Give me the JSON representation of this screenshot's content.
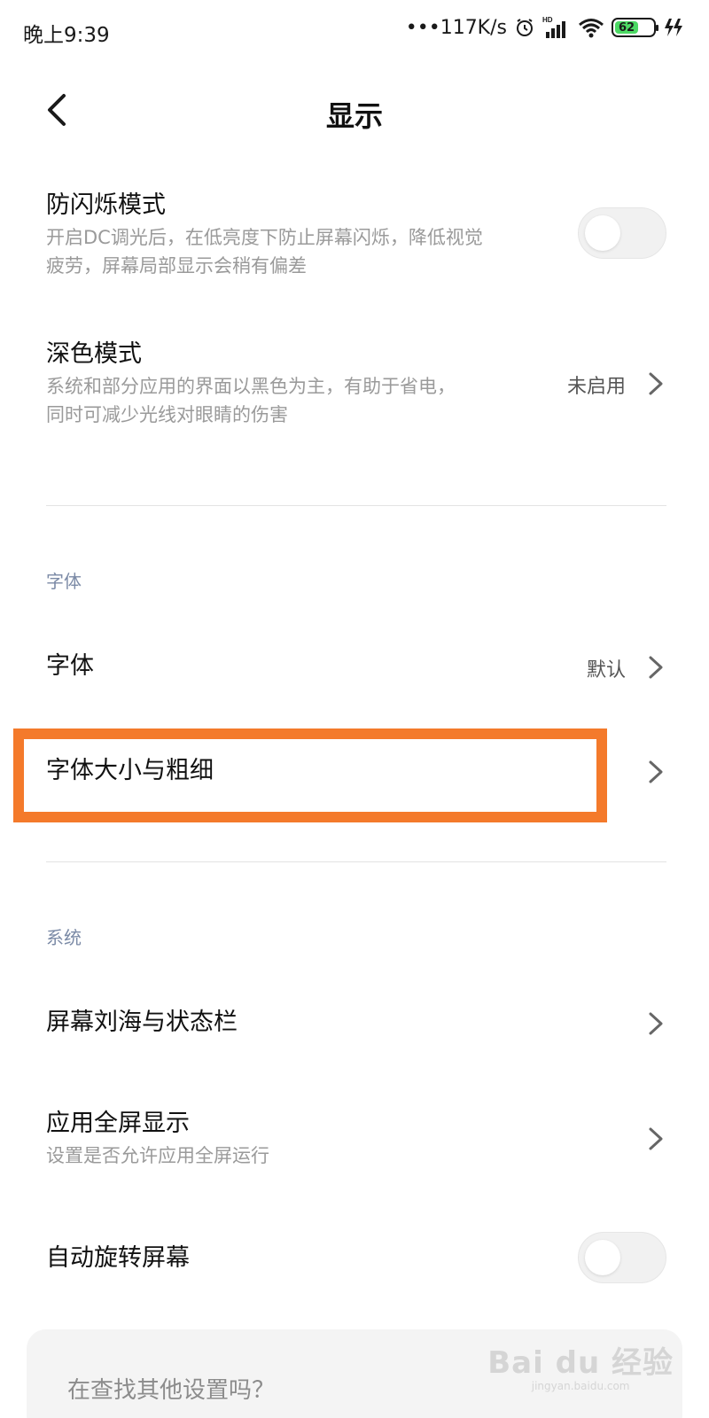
{
  "status_bar": {
    "time": "晚上9:39",
    "network_speed": "•••117K/s",
    "battery_level": "62",
    "icons": [
      "alarm-icon",
      "hd-signal-icon",
      "wifi-icon",
      "battery-icon",
      "charging-icon"
    ]
  },
  "header": {
    "title": "显示",
    "back_icon": "chevron-left-icon"
  },
  "settings": {
    "anti_flicker": {
      "title": "防闪烁模式",
      "desc_line1": "开启DC调光后，在低亮度下防止屏幕闪烁，降低视觉",
      "desc_line2": "疲劳，屏幕局部显示会稍有偏差",
      "enabled": false
    },
    "dark_mode": {
      "title": "深色模式",
      "desc_line1": "系统和部分应用的界面以黑色为主，有助于省电，",
      "desc_line2": "同时可减少光线对眼睛的伤害",
      "value": "未启用"
    }
  },
  "font_section": {
    "label": "字体",
    "font": {
      "title": "字体",
      "value": "默认"
    },
    "font_size": {
      "title": "字体大小与粗细"
    }
  },
  "system_section": {
    "label": "系统",
    "notch": {
      "title": "屏幕刘海与状态栏"
    },
    "fullscreen": {
      "title": "应用全屏显示",
      "desc": "设置是否允许应用全屏运行"
    },
    "auto_rotate": {
      "title": "自动旋转屏幕",
      "enabled": false
    }
  },
  "search_card": {
    "text": "在查找其他设置吗？"
  },
  "watermark": {
    "main": "Bai du 经验",
    "sub": "jingyan.baidu.com"
  },
  "colors": {
    "highlight": "#f47a2b",
    "section_label": "#7b8aa6",
    "battery": "#4cd964"
  }
}
